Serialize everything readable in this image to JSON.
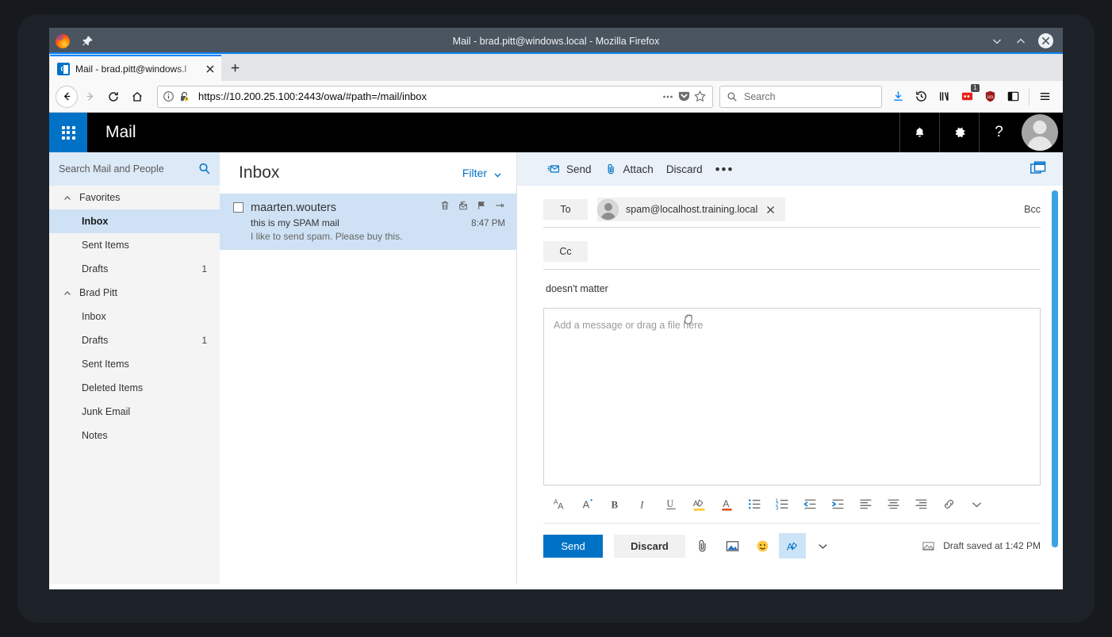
{
  "window": {
    "title": "Mail - brad.pitt@windows.local - Mozilla Firefox",
    "pin_icon": "pin-icon",
    "minimize_icon": "chevron-down-icon",
    "maximize_icon": "chevron-up-icon",
    "close_icon": "close-icon"
  },
  "browser": {
    "tab": {
      "title": "Mail - brad.pitt@windows.l",
      "favicon": "outlook-favicon",
      "close_icon": "close-icon"
    },
    "new_tab_label": "+",
    "nav": {
      "back_icon": "arrow-left-icon",
      "forward_icon": "arrow-right-icon",
      "reload_icon": "reload-icon",
      "home_icon": "home-icon"
    },
    "url": "https://10.200.25.100:2443/owa/#path=/mail/inbox",
    "url_icons": {
      "info": "info-icon",
      "lock_warning": "lock-warning-icon",
      "page_actions": "ellipsis-icon",
      "pocket": "pocket-icon",
      "bookmark": "star-icon"
    },
    "search": {
      "placeholder": "Search",
      "icon": "search-icon"
    },
    "toolbar_icons": [
      {
        "name": "downloads-icon",
        "badge": ""
      },
      {
        "name": "history-icon",
        "badge": ""
      },
      {
        "name": "library-icon",
        "badge": ""
      },
      {
        "name": "notification-icon",
        "badge": "1"
      },
      {
        "name": "ublock-origin-icon",
        "badge": ""
      },
      {
        "name": "sidebar-icon",
        "badge": ""
      },
      {
        "name": "hamburger-menu-icon",
        "badge": ""
      }
    ]
  },
  "owa": {
    "app_title": "Mail",
    "waffle_icon": "app-launcher-icon",
    "top_right": [
      {
        "name": "notifications-bell-icon",
        "glyph": "bell"
      },
      {
        "name": "settings-gear-icon",
        "glyph": "gear"
      },
      {
        "name": "help-icon",
        "glyph": "?"
      }
    ],
    "avatar_name": "user-avatar",
    "search": {
      "placeholder": "Search Mail and People",
      "icon": "search-icon"
    },
    "nav_groups": [
      {
        "header": "Favorites",
        "items": [
          {
            "label": "Inbox",
            "count": "",
            "selected": true
          },
          {
            "label": "Sent Items",
            "count": "",
            "selected": false
          },
          {
            "label": "Drafts",
            "count": "1",
            "selected": false
          }
        ]
      },
      {
        "header": "Brad Pitt",
        "items": [
          {
            "label": "Inbox",
            "count": "",
            "selected": false
          },
          {
            "label": "Drafts",
            "count": "1",
            "selected": false
          },
          {
            "label": "Sent Items",
            "count": "",
            "selected": false
          },
          {
            "label": "Deleted Items",
            "count": "",
            "selected": false
          },
          {
            "label": "Junk Email",
            "count": "",
            "selected": false
          },
          {
            "label": "Notes",
            "count": "",
            "selected": false
          }
        ]
      }
    ],
    "list": {
      "title": "Inbox",
      "filter_label": "Filter",
      "filter_chevron": "chevron-down-icon",
      "messages": [
        {
          "sender": "maarten.wouters",
          "subject": "this is my SPAM mail",
          "preview": "I like to send spam. Please buy this.",
          "time": "8:47 PM",
          "selected": true,
          "actions": [
            "delete-icon",
            "mark-read-icon",
            "flag-icon",
            "pin-icon"
          ]
        }
      ]
    },
    "compose": {
      "commands": [
        {
          "label": "Send",
          "icon": "send-icon"
        },
        {
          "label": "Attach",
          "icon": "paperclip-icon"
        },
        {
          "label": "Discard",
          "icon": ""
        }
      ],
      "more_commands": "•••",
      "popout_icon": "pop-out-icon",
      "to_label": "To",
      "to_recipient": "spam@localhost.training.local",
      "to_remove_icon": "close-icon",
      "bcc_label": "Bcc",
      "cc_label": "Cc",
      "subject_value": "doesn't matter",
      "body_placeholder": "Add a message or drag a file here",
      "format_icons": [
        "font-size-icon",
        "font-grow-icon",
        "bold-icon",
        "italic-icon",
        "underline-icon",
        "highlight-color-icon",
        "font-color-icon",
        "bulleted-list-icon",
        "numbered-list-icon",
        "decrease-indent-icon",
        "increase-indent-icon",
        "align-left-icon",
        "align-center-icon",
        "align-right-icon",
        "insert-link-icon",
        "more-formatting-icon"
      ],
      "send_label": "Send",
      "discard_label": "Discard",
      "action_icons": [
        {
          "name": "attach-paperclip-icon",
          "active": false
        },
        {
          "name": "insert-picture-icon",
          "active": false
        },
        {
          "name": "emoji-icon",
          "active": false
        },
        {
          "name": "formatting-pen-icon",
          "active": true
        },
        {
          "name": "more-options-chevron-icon",
          "active": false
        }
      ],
      "draft_status": "Draft saved at 1:42 PM",
      "draft_status_icon": "image-placeholder-icon"
    }
  }
}
